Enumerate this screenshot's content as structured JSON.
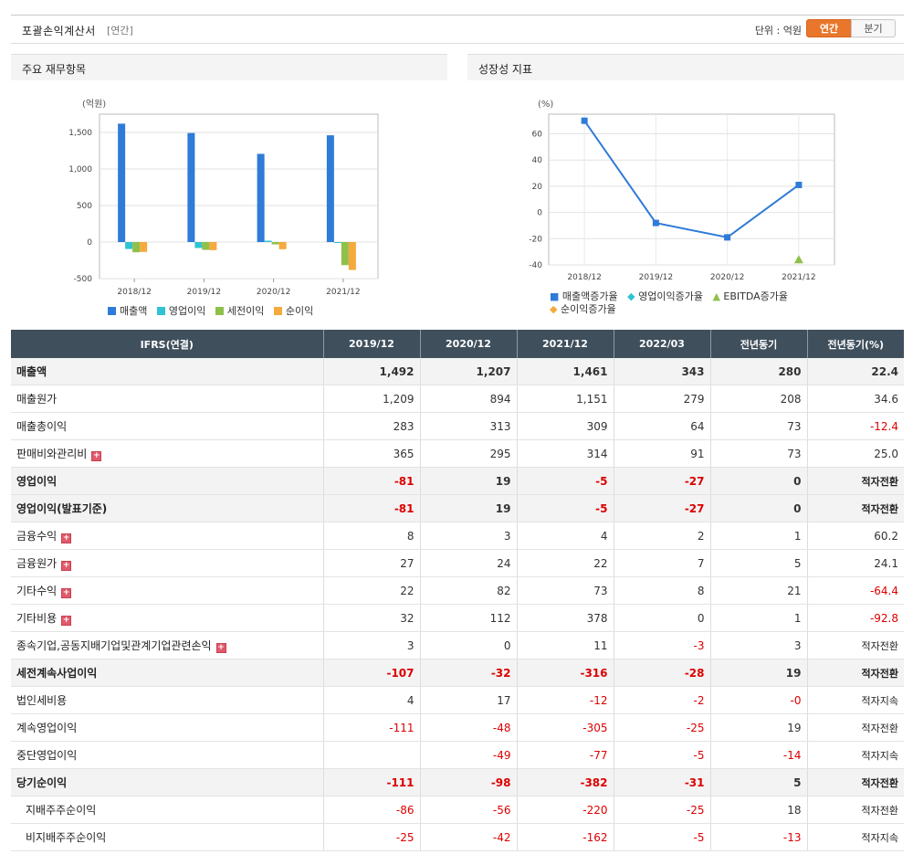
{
  "header": {
    "title": "포괄손익계산서",
    "period": "[연간]",
    "unit": "단위 : 억원",
    "btn_annual": "연간",
    "btn_quarter": "분기"
  },
  "left_panel": {
    "title": "주요 재무항목",
    "unit": "(억원)"
  },
  "right_panel": {
    "title": "성장성 지표",
    "unit": "(%)"
  },
  "chart_data": [
    {
      "type": "bar",
      "categories": [
        "2018/12",
        "2019/12",
        "2020/12",
        "2021/12"
      ],
      "ylim": [
        -500,
        1750
      ],
      "yticks": [
        "1,500",
        "1,000",
        "500",
        "0",
        "-500"
      ],
      "ytick_values": [
        1500,
        1000,
        500,
        0,
        -500
      ],
      "series": [
        {
          "name": "매출액",
          "color": "#2f7bd8",
          "values": [
            1620,
            1492,
            1207,
            1461
          ]
        },
        {
          "name": "영업이익",
          "color": "#30c3d3",
          "values": [
            -95,
            -81,
            19,
            -5
          ]
        },
        {
          "name": "세전이익",
          "color": "#8fc04a",
          "values": [
            -140,
            -107,
            -32,
            -316
          ]
        },
        {
          "name": "순이익",
          "color": "#f4aa3c",
          "values": [
            -135,
            -111,
            -98,
            -382
          ]
        }
      ],
      "grid": true,
      "legend": "bottom"
    },
    {
      "type": "line",
      "categories": [
        "2018/12",
        "2019/12",
        "2020/12",
        "2021/12"
      ],
      "ylim": [
        -40,
        75
      ],
      "yticks": [
        "60",
        "40",
        "20",
        "0",
        "-20",
        "-40"
      ],
      "ytick_values": [
        60,
        40,
        20,
        0,
        -20,
        -40
      ],
      "series": [
        {
          "name": "매출액증가율",
          "color": "#2f7bd8",
          "marker": "square",
          "values": [
            70,
            -8,
            -19,
            21
          ]
        },
        {
          "name": "영업이익증가율",
          "color": "#30c3d3",
          "marker": "diamond",
          "values": [
            null,
            null,
            null,
            null
          ]
        },
        {
          "name": "EBITDA증가율",
          "color": "#8fc04a",
          "marker": "triangle",
          "values": [
            null,
            null,
            null,
            -36
          ]
        },
        {
          "name": "순이익증가율",
          "color": "#f4aa3c",
          "marker": "diamond",
          "values": [
            null,
            null,
            null,
            null
          ]
        }
      ],
      "grid": true,
      "legend": "bottom"
    }
  ],
  "table": {
    "columns": [
      "IFRS(연결)",
      "2019/12",
      "2020/12",
      "2021/12",
      "2022/03",
      "전년동기",
      "전년동기(%)"
    ],
    "rows": [
      {
        "label": "매출액",
        "values": [
          "1,492",
          "1,207",
          "1,461",
          "343",
          "280",
          "22.4"
        ],
        "bold": true,
        "expand": false
      },
      {
        "label": "매출원가",
        "values": [
          "1,209",
          "894",
          "1,151",
          "279",
          "208",
          "34.6"
        ],
        "bold": false,
        "expand": false
      },
      {
        "label": "매출총이익",
        "values": [
          "283",
          "313",
          "309",
          "64",
          "73",
          "-12.4"
        ],
        "bold": false,
        "expand": false
      },
      {
        "label": "판매비와관리비",
        "values": [
          "365",
          "295",
          "314",
          "91",
          "73",
          "25.0"
        ],
        "bold": false,
        "expand": true
      },
      {
        "label": "영업이익",
        "values": [
          "-81",
          "19",
          "-5",
          "-27",
          "0",
          "적자전환"
        ],
        "bold": true,
        "expand": false
      },
      {
        "label": "영업이익(발표기준)",
        "values": [
          "-81",
          "19",
          "-5",
          "-27",
          "0",
          "적자전환"
        ],
        "bold": true,
        "expand": false
      },
      {
        "label": "금융수익",
        "values": [
          "8",
          "3",
          "4",
          "2",
          "1",
          "60.2"
        ],
        "bold": false,
        "expand": true
      },
      {
        "label": "금융원가",
        "values": [
          "27",
          "24",
          "22",
          "7",
          "5",
          "24.1"
        ],
        "bold": false,
        "expand": true
      },
      {
        "label": "기타수익",
        "values": [
          "22",
          "82",
          "73",
          "8",
          "21",
          "-64.4"
        ],
        "bold": false,
        "expand": true
      },
      {
        "label": "기타비용",
        "values": [
          "32",
          "112",
          "378",
          "0",
          "1",
          "-92.8"
        ],
        "bold": false,
        "expand": true
      },
      {
        "label": "종속기업,공동지배기업및관계기업관련손익",
        "values": [
          "3",
          "0",
          "11",
          "-3",
          "3",
          "적자전환"
        ],
        "bold": false,
        "expand": true
      },
      {
        "label": "세전계속사업이익",
        "values": [
          "-107",
          "-32",
          "-316",
          "-28",
          "19",
          "적자전환"
        ],
        "bold": true,
        "expand": false
      },
      {
        "label": "법인세비용",
        "values": [
          "4",
          "17",
          "-12",
          "-2",
          "-0",
          "적자지속"
        ],
        "bold": false,
        "expand": false
      },
      {
        "label": "계속영업이익",
        "values": [
          "-111",
          "-48",
          "-305",
          "-25",
          "19",
          "적자전환"
        ],
        "bold": false,
        "expand": false
      },
      {
        "label": "중단영업이익",
        "values": [
          "",
          "-49",
          "-77",
          "-5",
          "-14",
          "적자지속"
        ],
        "bold": false,
        "expand": false
      },
      {
        "label": "당기순이익",
        "values": [
          "-111",
          "-98",
          "-382",
          "-31",
          "5",
          "적자전환"
        ],
        "bold": true,
        "expand": false
      },
      {
        "label": "지배주주순이익",
        "values": [
          "-86",
          "-56",
          "-220",
          "-25",
          "18",
          "적자전환"
        ],
        "bold": false,
        "expand": false,
        "sub": true
      },
      {
        "label": "비지배주주순이익",
        "values": [
          "-25",
          "-42",
          "-162",
          "-5",
          "-13",
          "적자지속"
        ],
        "bold": false,
        "expand": false,
        "sub": true
      }
    ]
  }
}
